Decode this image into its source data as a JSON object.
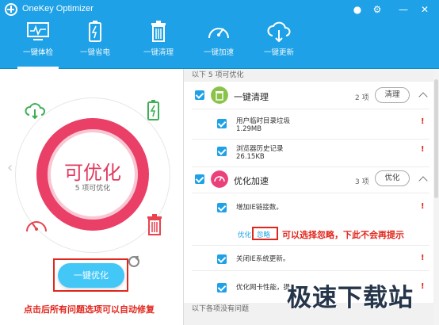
{
  "window": {
    "title": "OneKey Optimizer"
  },
  "title_controls": [
    "chat-icon",
    "gear-icon",
    "minimize-icon",
    "close-icon"
  ],
  "tabs": [
    {
      "label": "一键体检",
      "icon": "monitor-icon",
      "active": true
    },
    {
      "label": "一键省电",
      "icon": "battery-icon",
      "active": false
    },
    {
      "label": "一键清理",
      "icon": "trash-icon",
      "active": false
    },
    {
      "label": "一键加速",
      "icon": "speedometer-icon",
      "active": false
    },
    {
      "label": "一键更新",
      "icon": "cloud-download-icon",
      "active": false
    }
  ],
  "status": {
    "main": "可优化",
    "sub": "5 项可优化"
  },
  "optimize_button": "一键优化",
  "bottom_caption": "点击后所有问题选项可以自动修复",
  "right": {
    "banner_top": "以下 5 项可优化",
    "banner_bottom": "以下各项没有问题",
    "groups": [
      {
        "title": "一键清理",
        "count": "2 项",
        "button": "清理",
        "items": [
          {
            "text": "用户临时目录垃圾",
            "sub": "1.29MB"
          },
          {
            "text": "浏览器历史记录",
            "sub": "26.15KB"
          }
        ]
      },
      {
        "title": "优化加速",
        "count": "3 项",
        "button": "优化",
        "items": [
          {
            "text": "增加IE链接数。"
          },
          {
            "text": "关闭IE系统更新。"
          },
          {
            "text": "优化网卡性能，提"
          }
        ],
        "links": {
          "optimize": "优化",
          "ignore": "忽略"
        }
      }
    ],
    "ignore_hint": "可以选择忽略，下此不会再提示"
  },
  "watermark": "极速下载站",
  "colors": {
    "accent": "#1ea1e6",
    "alert": "#e1261c",
    "ring": "#ea3f66",
    "button": "#43c7f7"
  }
}
